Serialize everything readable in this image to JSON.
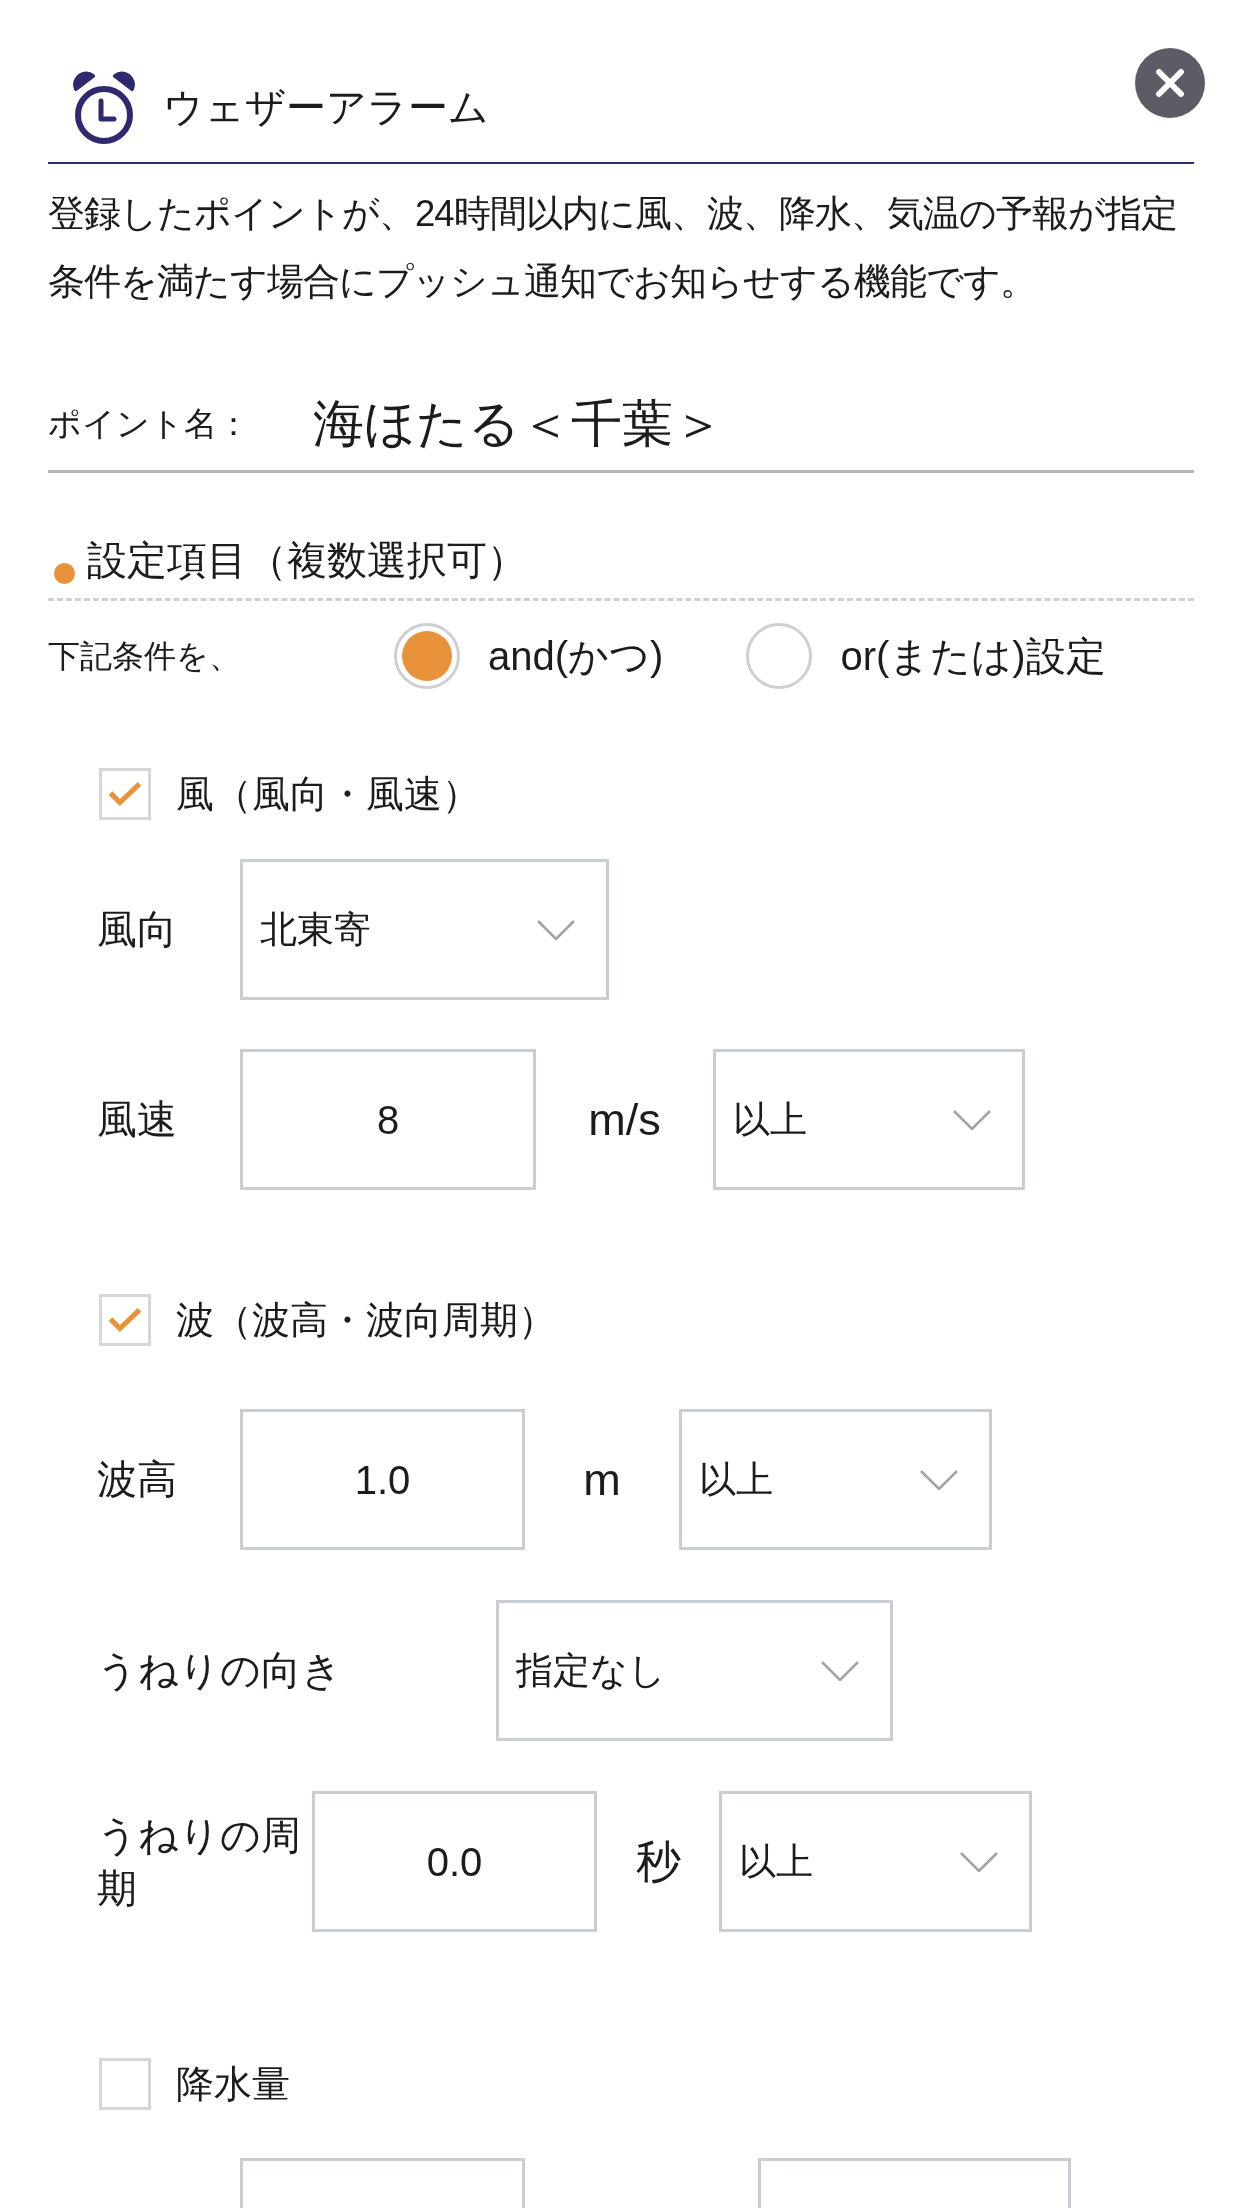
{
  "header": {
    "title": "ウェザーアラーム"
  },
  "description": "登録したポイントが、24時間以内に風、波、降水、気温の予報が指定条件を満たす場合にプッシュ通知でお知らせする機能です。",
  "point": {
    "label": "ポイント名：",
    "value": "海ほたる＜千葉＞"
  },
  "settings": {
    "title": "設定項目（複数選択可）",
    "condition_label": "下記条件を、",
    "modes": [
      {
        "label": "and(かつ)",
        "selected": true
      },
      {
        "label": "or(または)設定",
        "selected": false
      }
    ]
  },
  "groups": [
    {
      "label": "風（風向・風速）",
      "checked": true,
      "rows": [
        {
          "kind": "select",
          "label": "風向",
          "value": "北東寄"
        },
        {
          "kind": "measure",
          "label": "風速",
          "value": "8",
          "unit": "m/s",
          "condition": "以上"
        }
      ]
    },
    {
      "label": "波（波高・波向周期）",
      "checked": true,
      "rows": [
        {
          "kind": "measure",
          "label": "波高",
          "value": "1.0",
          "unit": "m",
          "condition": "以上"
        },
        {
          "kind": "select",
          "label": "うねりの向き",
          "value": "指定なし"
        },
        {
          "kind": "measure",
          "label": "うねりの周期",
          "value": "0.0",
          "unit": "秒",
          "condition": "以上"
        }
      ]
    },
    {
      "label": "降水量",
      "checked": false,
      "rows": [
        {
          "kind": "measure"
        }
      ]
    }
  ]
}
